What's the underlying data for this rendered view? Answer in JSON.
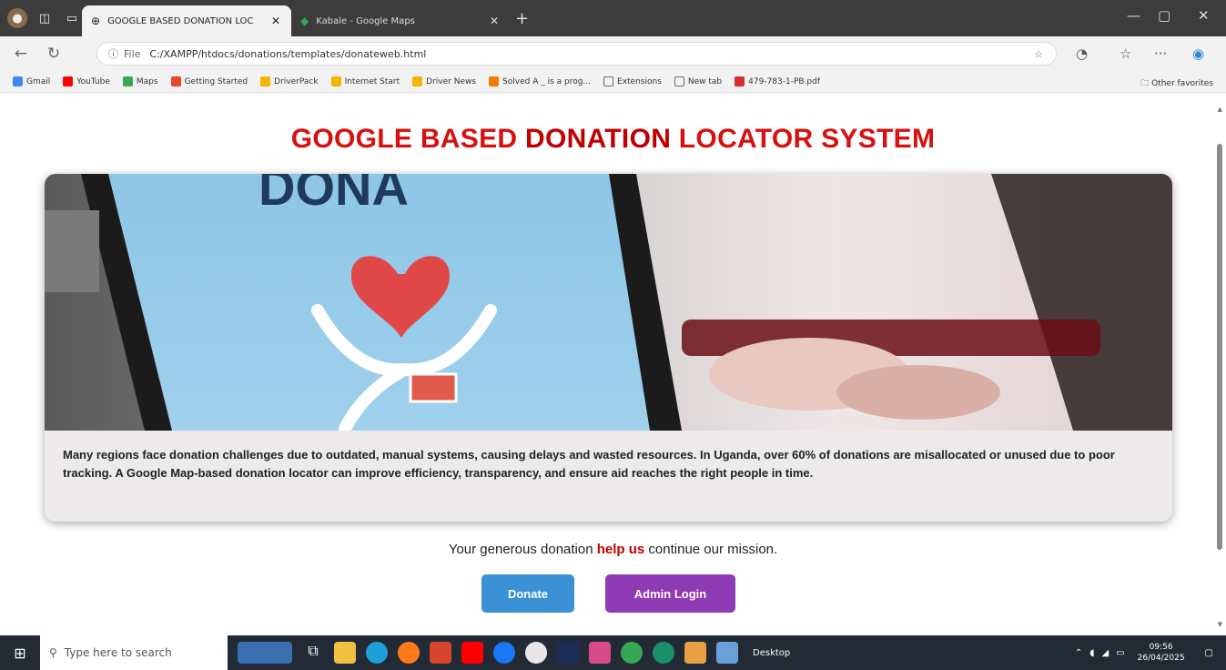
{
  "browser": {
    "tabs": [
      {
        "label": "GOOGLE BASED DONATION LOC",
        "active": true
      },
      {
        "label": "Kabale - Google Maps",
        "active": false
      }
    ],
    "url": "C:/XAMPP/htdocs/donations/templates/donateweb.html",
    "url_scheme": "File",
    "bookmarks": [
      {
        "label": "Gmail",
        "color": "#4285f4"
      },
      {
        "label": "YouTube",
        "color": "#ff0000"
      },
      {
        "label": "Maps",
        "color": "#34a853"
      },
      {
        "label": "Getting Started",
        "color": "#e8452c"
      },
      {
        "label": "DriverPack",
        "color": "#f5b400"
      },
      {
        "label": "Internet Start",
        "color": "#f5b400"
      },
      {
        "label": "Driver News",
        "color": "#f5b400"
      },
      {
        "label": "Solved A _ is a prog...",
        "color": "#f57c00"
      },
      {
        "label": "Extensions",
        "color": "#666666"
      },
      {
        "label": "New tab",
        "color": "#666666"
      },
      {
        "label": "479-783-1-PB.pdf",
        "color": "#d32f2f"
      }
    ],
    "other_favorites": "Other favorites"
  },
  "page": {
    "title_part1": "GOOGLE BASED ",
    "title_part2": "DONATION",
    "title_part3": " LOCATOR SYSTEM",
    "hero_text": "DONA",
    "description": "Many regions face donation challenges due to outdated, manual systems, causing delays and wasted resources. In Uganda, over 60% of donations are misallocated or unused due to poor tracking. A Google Map-based donation locator can improve efficiency, transparency, and ensure aid reaches the right people in time.",
    "mission_part1": "Your generous donation ",
    "mission_highlight": "help us",
    "mission_part2": " continue our mission.",
    "donate_label": "Donate",
    "admin_label": "Admin Login",
    "colors": {
      "title": "#d71010",
      "donate": "#3a91d6",
      "admin": "#8f3bb5"
    }
  },
  "taskbar": {
    "search_placeholder": "Type here to search",
    "desktop_label": "Desktop",
    "time": "09:56",
    "date": "26/04/2025"
  }
}
